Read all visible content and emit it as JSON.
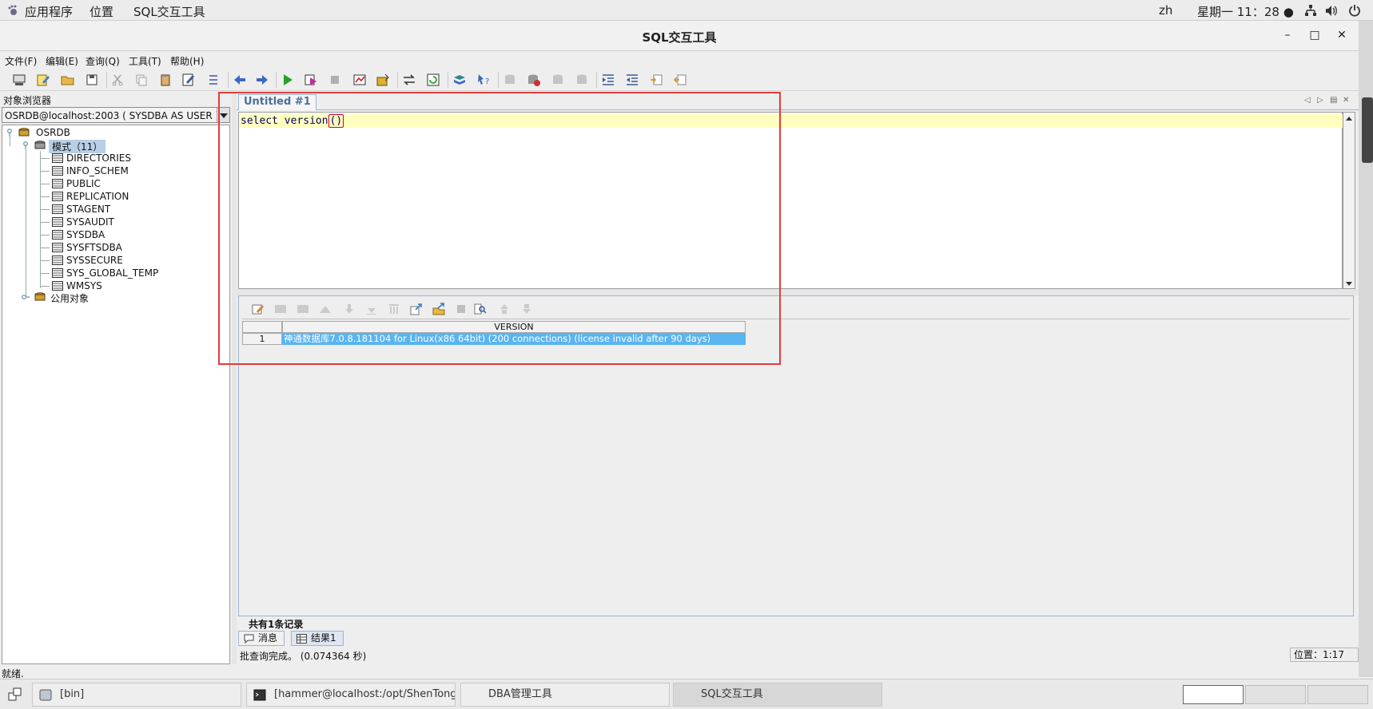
{
  "topbar": {
    "apps": "应用程序",
    "places": "位置",
    "active_app": "SQL交互工具",
    "lang": "zh",
    "clock": "星期一 11：28 ●"
  },
  "window": {
    "title": "SQL交互工具",
    "min": "–",
    "max": "□",
    "close": "✕"
  },
  "menubar": {
    "file": "文件(F)",
    "edit": "编辑(E)",
    "query": "查询(Q)",
    "tools": "工具(T)",
    "help": "帮助(H)"
  },
  "object_browser": {
    "header": "对象浏览器",
    "connection": "OSRDB@localhost:2003 ( SYSDBA AS USER )",
    "tree": {
      "root": "OSRDB",
      "schemas": "模式（11）",
      "items": [
        "DIRECTORIES",
        "INFO_SCHEM",
        "PUBLIC",
        "REPLICATION",
        "STAGENT",
        "SYSAUDIT",
        "SYSDBA",
        "SYSFTSDBA",
        "SYSSECURE",
        "SYS_GLOBAL_TEMP",
        "WMSYS"
      ],
      "public_objects": "公用对象"
    }
  },
  "editor": {
    "tab": "Untitled #1",
    "code_before": "select version",
    "code_cursor": "()"
  },
  "results": {
    "column": "VERSION",
    "rows": [
      {
        "num": "1",
        "value": "神通数据库7.0.8.181104 for Linux(x86 64bit) (200 connections) (license invalid after 90 days)"
      }
    ],
    "record_count": "共有1条记录",
    "tab_messages": "消息",
    "tab_result": "结果1"
  },
  "status": {
    "message": "批查询完成。 (0.074364 秒)",
    "position": "位置：1:17",
    "app": "就绪."
  },
  "taskbar": {
    "task1": "[bin]",
    "task2": "[hammer@localhost:/opt/ShenTong-...",
    "task3": "DBA管理工具",
    "task4": "SQL交互工具"
  }
}
